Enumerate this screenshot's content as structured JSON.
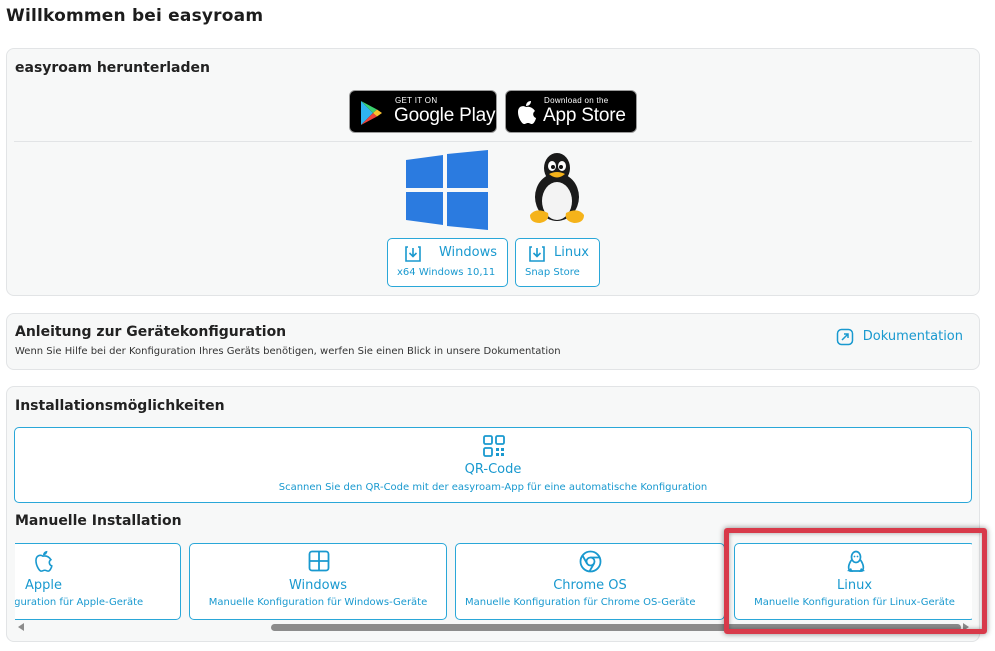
{
  "page": {
    "title": "Willkommen bei easyroam"
  },
  "download": {
    "title": "easyroam herunterladen",
    "google_play": {
      "small": "GET IT ON",
      "big": "Google Play"
    },
    "app_store": {
      "small": "Download on the",
      "big": "App Store"
    },
    "windows": {
      "label": "Windows",
      "sub": "x64 Windows 10,11"
    },
    "linux": {
      "label": "Linux",
      "sub": "Snap Store"
    }
  },
  "guide": {
    "title": "Anleitung zur Gerätekonfiguration",
    "description": "Wenn Sie Hilfe bei der Konfiguration Ihres Geräts benötigen, werfen Sie einen Blick in unsere Dokumentation",
    "doc_link": "Dokumentation"
  },
  "install": {
    "title": "Installationsmöglichkeiten",
    "qr": {
      "label": "QR-Code",
      "description": "Scannen Sie den QR-Code mit der easyroam-App für eine automatische Konfiguration"
    },
    "manual_title": "Manuelle Installation",
    "platforms": [
      {
        "name": "Apple",
        "description": "Manuelle Konfiguration für Apple-Geräte",
        "icon": "apple-icon"
      },
      {
        "name": "Windows",
        "description": "Manuelle Konfiguration für Windows-Geräte",
        "icon": "windows-icon"
      },
      {
        "name": "Chrome OS",
        "description": "Manuelle Konfiguration für Chrome OS-Geräte",
        "icon": "chrome-icon"
      },
      {
        "name": "Linux",
        "description": "Manuelle Konfiguration für Linux-Geräte",
        "icon": "linux-icon"
      }
    ]
  },
  "colors": {
    "accent": "#1999cf",
    "border": "#2aa7d8",
    "highlight": "#d83a4a",
    "windows_blue": "#2b7be0"
  }
}
